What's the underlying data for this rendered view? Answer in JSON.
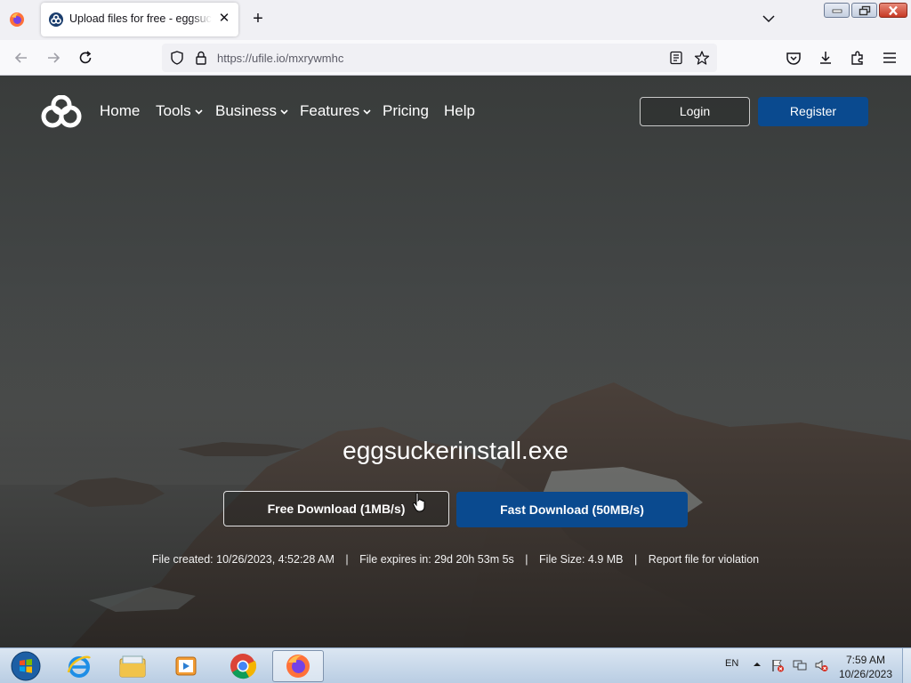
{
  "browser": {
    "tab": {
      "title": "Upload files for free - eggsucke",
      "close_glyph": "✕"
    },
    "new_tab_glyph": "+",
    "url": "https://ufile.io/mxrywmhc"
  },
  "site": {
    "nav": [
      {
        "label": "Home",
        "has_caret": false
      },
      {
        "label": "Tools",
        "has_caret": true
      },
      {
        "label": "Business",
        "has_caret": true
      },
      {
        "label": "Features",
        "has_caret": true
      },
      {
        "label": "Pricing",
        "has_caret": false
      },
      {
        "label": "Help",
        "has_caret": false
      }
    ],
    "login_label": "Login",
    "register_label": "Register",
    "file_name": "eggsuckerinstall.exe",
    "free_download_label": "Free Download (1MB/s)",
    "fast_download_label": "Fast Download (50MB/s)",
    "file_info": {
      "created": "File created: 10/26/2023, 4:52:28 AM",
      "expires": "File expires in: 29d 20h 53m 5s",
      "size": "File Size: 4.9 MB",
      "report": "Report file for violation",
      "separator": "|"
    },
    "colors": {
      "accent": "#0a4a8f",
      "text": "#ffffff"
    }
  },
  "taskbar": {
    "apps": [
      "start-orb",
      "internet-explorer",
      "file-explorer",
      "media-player",
      "chrome",
      "firefox"
    ],
    "language": "EN",
    "time": "7:59 AM",
    "date": "10/26/2023"
  }
}
